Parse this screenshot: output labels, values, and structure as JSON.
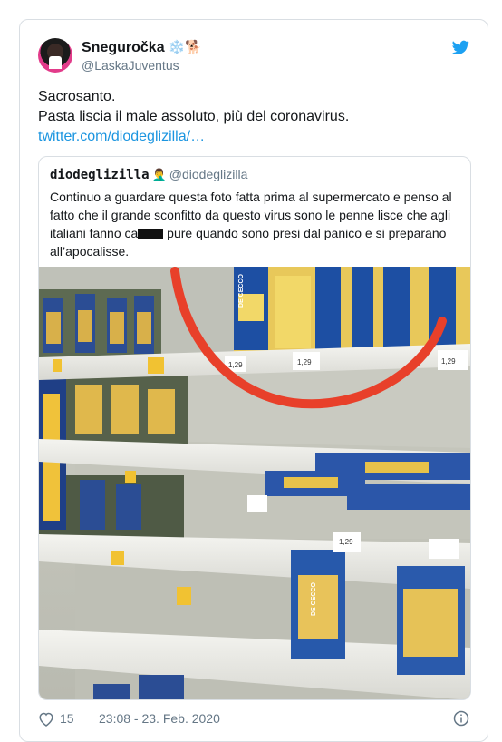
{
  "tweet": {
    "author": {
      "name": "Sneguročka",
      "emoji": "❄️🐕",
      "handle": "@LaskaJuventus"
    },
    "lines": [
      "Sacrosanto.",
      "Pasta liscia il male assoluto, più del coronavirus."
    ],
    "link": "twitter.com/diodeglizilla/…",
    "likes": "15",
    "timestamp": "23:08 - 23. Feb. 2020"
  },
  "quoted": {
    "name": "diodeglizilla",
    "emoji": "🤦‍♂️",
    "handle": "@diodeglizilla",
    "lines": [
      "Continuo a guardare questa foto fatta prima al supermercato e penso al",
      "fatto che il grande sconfitto da questo virus sono le penne lisce che agli"
    ],
    "line3_before": "italiani fanno ca",
    "line3_after": " pure quando sono presi dal panico e si preparano",
    "line4": "all’apocalisse.",
    "photo": {
      "brand": "DE CECCO",
      "price_tags": [
        "1,29",
        "1,29",
        "1,29",
        "1,29"
      ],
      "accent": "#e8402a"
    }
  },
  "colors": {
    "link": "#1b95e0",
    "twitter_blue": "#1da1f2",
    "muted": "#657786"
  }
}
